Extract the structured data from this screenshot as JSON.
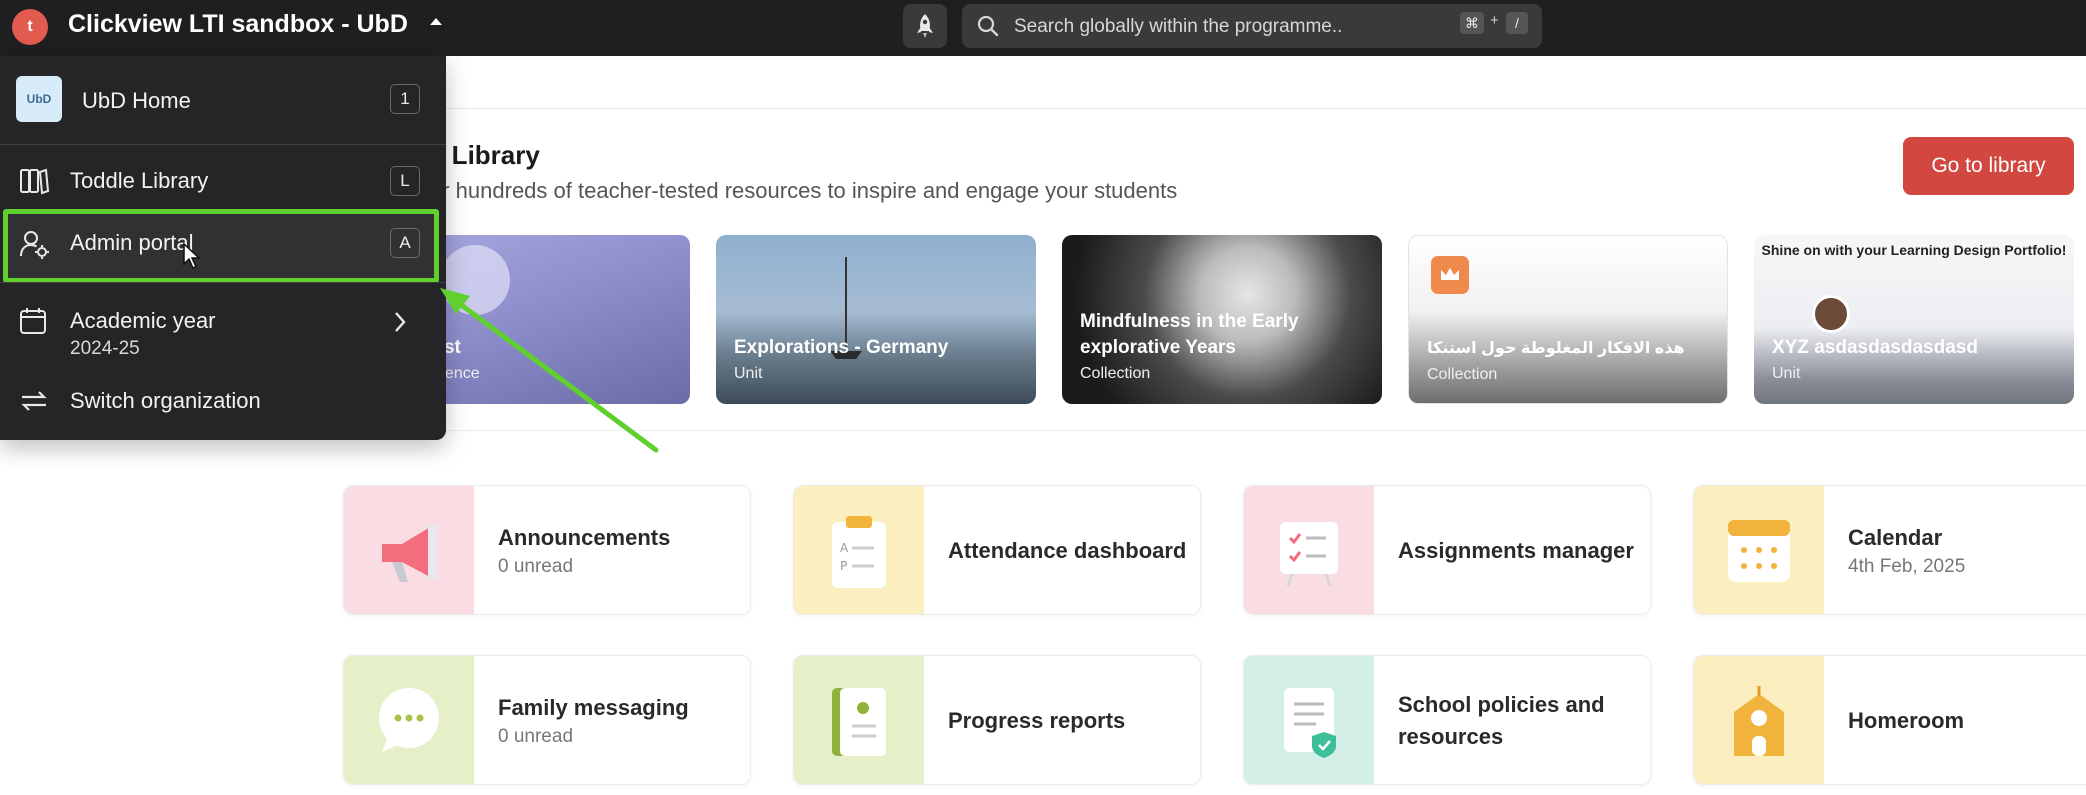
{
  "topbar": {
    "logo_letter": "t",
    "org_title": "Clickview LTI sandbox - UbD",
    "search_placeholder": "Search globally within the programme..",
    "shortcut_keys": [
      "⌘",
      "/"
    ],
    "shortcut_plus": "+"
  },
  "dropdown": {
    "home": {
      "badge": "UbD",
      "label": "UbD Home",
      "key": "1"
    },
    "items": [
      {
        "label": "Toddle Library",
        "key": "L",
        "icon": "book-icon"
      },
      {
        "label": "Admin portal",
        "key": "A",
        "icon": "user-gear-icon"
      },
      {
        "label": "Academic year",
        "sub": "2024-25",
        "icon": "calendar-icon"
      },
      {
        "label": "Switch organization",
        "icon": "switch-arrows-icon"
      }
    ]
  },
  "library": {
    "title": "e Library",
    "subtitle": "er hundreds of teacher-tested resources to inspire and engage your students",
    "button": "Go to library",
    "cards": [
      {
        "title": "ook test",
        "type": "g experience"
      },
      {
        "title": "Explorations - Germany",
        "type": "Unit"
      },
      {
        "title": "Mindfulness in the Early explorative Years",
        "type": "Collection"
      },
      {
        "title": "هذه الافكار المغلوطة حول استنكا",
        "type": "Collection"
      },
      {
        "title": "XYZ asdasdasdasdasd",
        "type": "Unit",
        "promo": "Shine on with your Learning Design Portfolio!"
      }
    ]
  },
  "tiles": [
    {
      "title": "Announcements",
      "sub": "0 unread",
      "bg": "#f9dde3"
    },
    {
      "title": "Attendance dashboard",
      "sub": "",
      "bg": "#fbeebf"
    },
    {
      "title": "Assignments manager",
      "sub": "",
      "bg": "#f9dde3"
    },
    {
      "title": "Calendar",
      "sub": "4th Feb, 2025",
      "bg": "#fbeebf"
    },
    {
      "title": "Family messaging",
      "sub": "0 unread",
      "bg": "#e5f0c8"
    },
    {
      "title": "Progress reports",
      "sub": "",
      "bg": "#e5f0c8"
    },
    {
      "title": "School policies and resources",
      "sub": "",
      "bg": "#d3efe8"
    },
    {
      "title": "Homeroom",
      "sub": "",
      "bg": "#fbeebf"
    }
  ],
  "colors": {
    "topbar": "#1f1f21",
    "dropdown": "#252528",
    "accent_red": "#d2473f",
    "highlight_green": "#5fd02d"
  }
}
